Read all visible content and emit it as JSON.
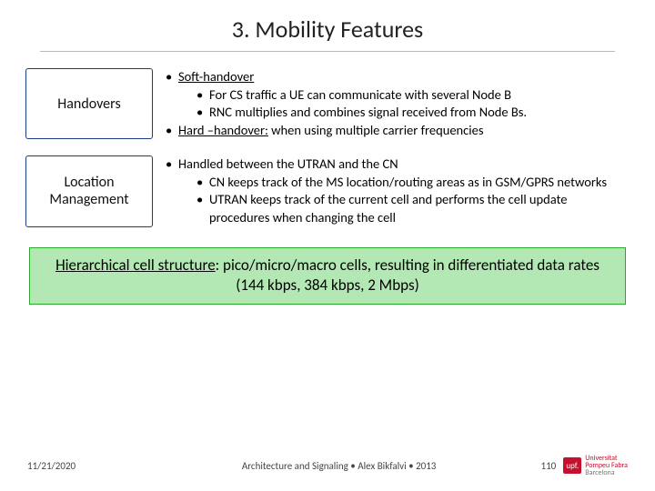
{
  "title": "3. Mobility Features",
  "row1": {
    "label": "Handovers",
    "soft_head": "Soft-handover",
    "soft_b1": "For CS  traffic a UE can communicate with several Node B",
    "soft_b2": "RNC multiplies and combines signal received from Node Bs.",
    "hard_head": "Hard –handover:",
    "hard_tail": " when using  multiple carrier frequencies"
  },
  "row2": {
    "label": "Location Management",
    "head": "Handled between the UTRAN and the CN",
    "b1": "CN keeps track of the MS location/routing areas as in GSM/GPRS networks",
    "b2": "UTRAN keeps track of the current cell and  performs the cell update procedures when changing the cell"
  },
  "green": {
    "u": "Hierarchical cell structure",
    "tail": ": pico/micro/macro cells, resulting in differentiated data rates (144 kbps, 384 kbps, 2 Mbps)"
  },
  "footer": {
    "date": "11/21/2020",
    "center": "Architecture and Signaling • Alex Bikfalvi • 2013",
    "page": "110",
    "logo_top": "Universitat",
    "logo_mid": "Pompeu Fabra",
    "logo_sub": "Barcelona",
    "logo_badge": "upf."
  }
}
